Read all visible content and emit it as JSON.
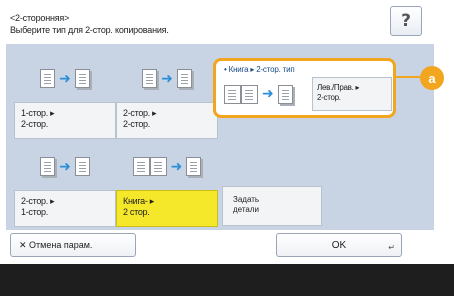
{
  "header": {
    "mode_title": "<2-сторонняя>",
    "prompt": "Выберите тип для 2-стор. копирования.",
    "help_label": "?"
  },
  "options": [
    {
      "label_line1": "1-стор. ▸",
      "label_line2": "2-стор."
    },
    {
      "label_line1": "2-стор. ▸",
      "label_line2": "2-стор."
    },
    {
      "label_line1": "2-стор. ▸",
      "label_line2": "1-стор."
    },
    {
      "label_line1": "Книга- ▸",
      "label_line2": "2 стор.",
      "selected": true
    }
  ],
  "book_panel": {
    "title": "• Книга ▸ 2-стор. тип",
    "button_line1": "Лев./Прав. ▸",
    "button_line2": "2-стор."
  },
  "callout": {
    "label": "a",
    "color": "#f2a51e"
  },
  "details_button": {
    "line1": "Задать",
    "line2": "детали"
  },
  "footer": {
    "cancel_label": "✕ Отмена парам.",
    "ok_label": "OK"
  },
  "colors": {
    "selected": "#f5e82b",
    "arrow": "#2b8fd6",
    "panel_bg": "#c8d3e3"
  }
}
